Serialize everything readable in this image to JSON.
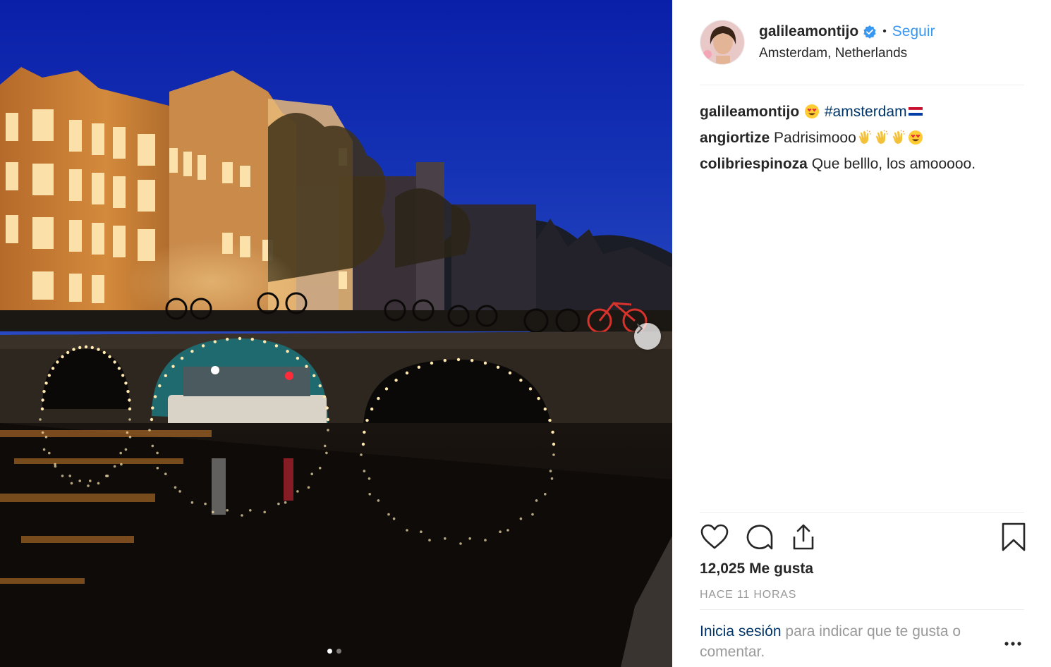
{
  "post": {
    "carousel": {
      "slide_count": 2,
      "active_index": 0
    },
    "next_icon": "chevron-right-icon"
  },
  "header": {
    "username": "galileamontijo",
    "verified": true,
    "separator": "•",
    "follow_label": "Seguir",
    "location": "Amsterdam, Netherlands"
  },
  "comments": [
    {
      "author": "galileamontijo",
      "emoji_before": "heart-eyes",
      "hashtag": "#amsterdam",
      "emoji_after": "netherlands-flag"
    },
    {
      "author": "angiortize",
      "text": "Padrisimooo",
      "emojis": [
        "clap",
        "clap",
        "clap",
        "heart-eyes"
      ]
    },
    {
      "author": "colibriespinoza",
      "text": "Que belllo, los amooooo."
    }
  ],
  "actions": {
    "like_icon": "heart-icon",
    "comment_icon": "comment-icon",
    "share_icon": "share-icon",
    "save_icon": "bookmark-icon"
  },
  "likes_text": "12,025 Me gusta",
  "timestamp": "HACE 11 HORAS",
  "login_prompt": {
    "link": "Inicia sesión",
    "text": "para indicar que te gusta o comentar."
  },
  "colors": {
    "accent": "#3897f0",
    "link": "#003569",
    "muted": "#999999",
    "text": "#262626"
  }
}
